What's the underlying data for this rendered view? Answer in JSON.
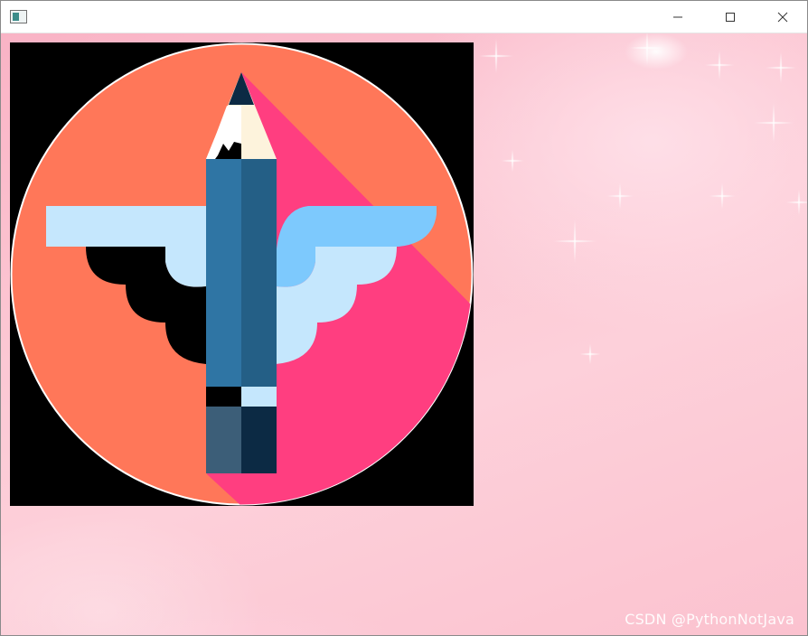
{
  "window": {
    "title": "",
    "icon": "app-window-icon",
    "controls": {
      "minimize_icon": "minimize-icon",
      "maximize_icon": "maximize-icon",
      "close_icon": "close-icon"
    }
  },
  "content": {
    "image": {
      "icon": "winged-pencil-logo",
      "colors": {
        "circle_main": "#ff7759",
        "circle_shadow": "#ff3e80",
        "wing_light": "#c5e7fd",
        "wing_dark": "#7dc9fd",
        "pencil_left": "#2f75a4",
        "pencil_right": "#245f86",
        "pencil_tip": "#0c2a44",
        "pencil_wood": "#fdf3dc",
        "pencil_band": "#c5e7fd",
        "pencil_eraser_left": "#3c5e78",
        "pencil_eraser_right": "#0c2a44",
        "background": "#000000"
      }
    },
    "watermark": "CSDN @PythonNotJava",
    "background_accent": "#fcc7d3"
  }
}
